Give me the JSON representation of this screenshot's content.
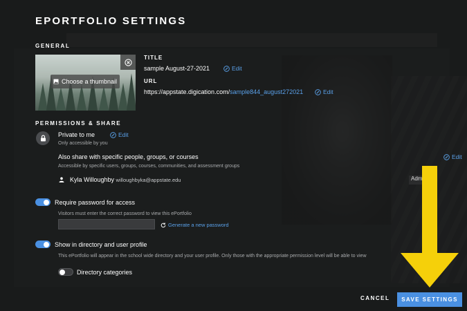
{
  "page": {
    "title": "EPORTFOLIO SETTINGS"
  },
  "general": {
    "section_label": "GENERAL",
    "thumbnail_button": "Choose a thumbnail",
    "title_label": "TITLE",
    "title_value": "sample August-27-2021",
    "url_label": "URL",
    "url_base": "https://appstate.digication.com/",
    "url_slug": "sample844_august272021",
    "edit_label": "Edit"
  },
  "permissions": {
    "section_label": "PERMISSIONS & SHARE",
    "private_title": "Private to me",
    "private_sub": "Only accessible by you",
    "share_title": "Also share with specific people, groups, or courses",
    "share_sub": "Accessible by specific users, groups, courses, communities, and assessment groups",
    "user_name": "Kyla Willoughby",
    "user_email": "willoughbyka@appstate.edu",
    "user_role": "Adm",
    "edit_label": "Edit"
  },
  "password": {
    "toggle_on": true,
    "label": "Require password for access",
    "hint": "Visitors must enter the correct password to view this ePortfolio",
    "value": "",
    "generate_label": "Generate a new password"
  },
  "directory": {
    "toggle_on": true,
    "label": "Show in directory and user profile",
    "hint": "This ePortfolio will appear in the school wide directory and your user profile. Only those with the appropriate permission level will be able to view",
    "categories_toggle_on": false,
    "categories_label": "Directory categories"
  },
  "footer": {
    "cancel_label": "CANCEL",
    "save_label": "SAVE SETTINGS"
  },
  "colors": {
    "accent": "#4a90e2",
    "link": "#5aa0e8",
    "arrow": "#f5d00a"
  },
  "icons": [
    "close-circle-icon",
    "image-icon",
    "edit-icon",
    "lock-icon",
    "person-icon",
    "refresh-icon",
    "arrow-down-icon"
  ]
}
